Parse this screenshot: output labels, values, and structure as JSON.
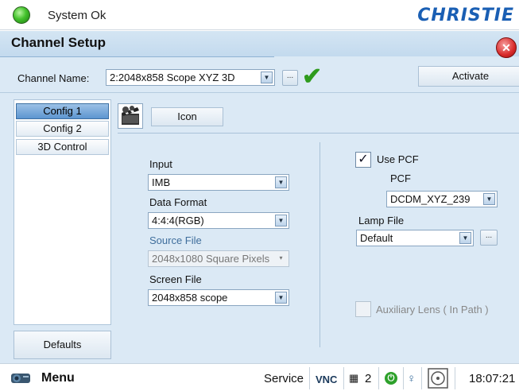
{
  "status": {
    "text": "System Ok",
    "led_color": "#44c22c"
  },
  "brand": "CHRISTIE",
  "page": {
    "title": "Channel Setup"
  },
  "channel": {
    "label": "Channel Name:",
    "value": "2:2048x858 Scope XYZ 3D",
    "browse": "...",
    "activate": "Activate"
  },
  "sidebar": {
    "items": [
      {
        "label": "Config 1",
        "active": true
      },
      {
        "label": "Config 2",
        "active": false
      },
      {
        "label": "3D Control",
        "active": false
      }
    ],
    "defaults": "Defaults"
  },
  "config": {
    "icon_button": "Icon",
    "input": {
      "label": "Input",
      "value": "IMB"
    },
    "data_format": {
      "label": "Data Format",
      "value": "4:4:4(RGB)"
    },
    "source_file": {
      "label": "Source File",
      "value": "2048x1080 Square Pixels"
    },
    "screen_file": {
      "label": "Screen File",
      "value": "2048x858 scope"
    },
    "use_pcf": {
      "label": "Use PCF",
      "checked": true
    },
    "pcf": {
      "label": "PCF",
      "value": "DCDM_XYZ_239"
    },
    "lamp_file": {
      "label": "Lamp File",
      "value": "Default",
      "browse": "..."
    },
    "aux_lens": {
      "label": "Auxiliary Lens ( In Path )",
      "checked": false
    }
  },
  "bottombar": {
    "menu": "Menu",
    "service": "Service",
    "vnc": "VNC",
    "channel_num": "2",
    "time": "18:07:21"
  },
  "icons": [
    "status-led-icon",
    "close-icon",
    "checkmark-icon",
    "clapperboard-icon",
    "chevron-down-icon",
    "projector-icon",
    "power-icon",
    "lamp-icon",
    "film-icon"
  ]
}
